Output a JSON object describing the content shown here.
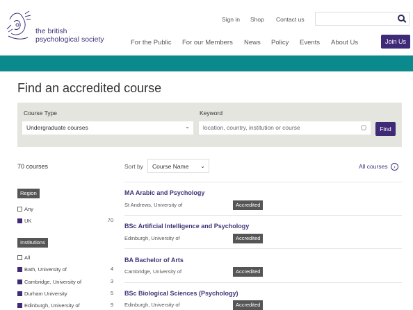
{
  "header": {
    "logo_line1": "the british",
    "logo_line2": "psychological society",
    "top_links": [
      "Sign in",
      "Shop",
      "Contact us"
    ],
    "nav": [
      "For the Public",
      "For our Members",
      "News",
      "Policy",
      "Events",
      "About Us"
    ],
    "join_label": "Join Us",
    "search_placeholder": ""
  },
  "page": {
    "title": "Find an accredited course"
  },
  "filters": {
    "course_type_label": "Course Type",
    "course_type_value": "Undergraduate courses",
    "keyword_label": "Keyword",
    "keyword_placeholder": "location, country, institution or course",
    "find_label": "Find"
  },
  "results_bar": {
    "count": "70 courses",
    "sort_label": "Sort by",
    "sort_value": "Course Name",
    "all_courses": "All courses"
  },
  "sidebar": {
    "region_label": "Region",
    "region_options": [
      {
        "label": "Any",
        "checked": false,
        "count": ""
      },
      {
        "label": "UK",
        "checked": true,
        "count": "70"
      }
    ],
    "institutions_label": "Institutions",
    "institution_options": [
      {
        "label": "All",
        "checked": false,
        "count": ""
      },
      {
        "label": "Bath, University of",
        "checked": true,
        "count": "4"
      },
      {
        "label": "Cambridge, University of",
        "checked": true,
        "count": "3"
      },
      {
        "label": "Durham University",
        "checked": true,
        "count": "5"
      },
      {
        "label": "Edinburgh, University of",
        "checked": true,
        "count": "9"
      }
    ]
  },
  "courses": [
    {
      "title": "MA Arabic and Psychology",
      "institution": "St Andrews, University of",
      "status": "Accredited"
    },
    {
      "title": "BSc Artificial Intelligence and Psychology",
      "institution": "Edinburgh, University of",
      "status": "Accredited"
    },
    {
      "title": "BA Bachelor of Arts",
      "institution": "Cambridge, University of",
      "status": "Accredited"
    },
    {
      "title": "BSc Biological Sciences (Psychology)",
      "institution": "Edinburgh, University of",
      "status": "Accredited"
    }
  ],
  "colors": {
    "brand": "#3f2a77",
    "teal": "#0a8a8c",
    "filter_bg": "#e4e5df"
  }
}
